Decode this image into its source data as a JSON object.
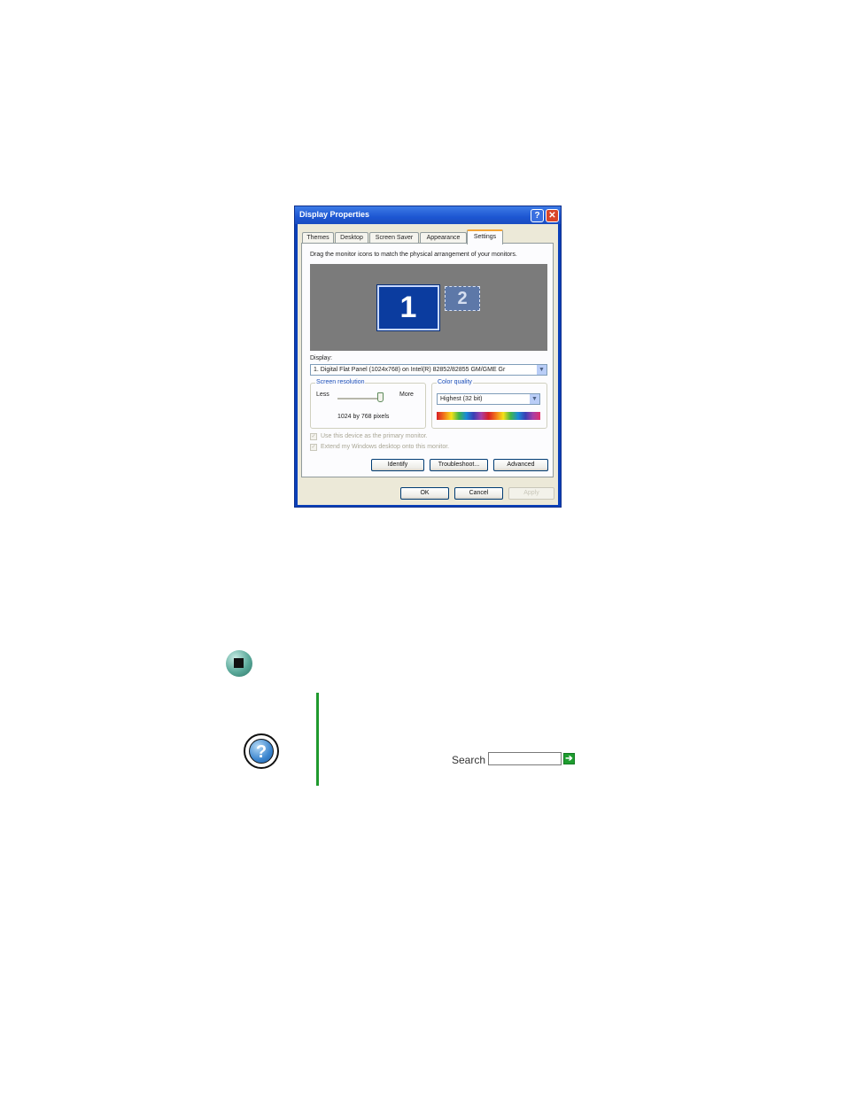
{
  "dialog": {
    "title": "Display Properties",
    "help_glyph": "?",
    "close_glyph": "✕",
    "tabs": [
      {
        "label": "Themes"
      },
      {
        "label": "Desktop"
      },
      {
        "label": "Screen Saver"
      },
      {
        "label": "Appearance"
      },
      {
        "label": "Settings"
      }
    ],
    "active_tab": "Settings",
    "instruction": "Drag the monitor icons to match the physical arrangement of your monitors.",
    "monitors": [
      {
        "label": "1",
        "selected": true
      },
      {
        "label": "2",
        "selected": false
      }
    ],
    "display_label": "Display:",
    "display_value": "1. Digital Flat Panel (1024x768) on Intel(R) 82852/82855 GM/GME Gr",
    "screen_resolution": {
      "title": "Screen resolution",
      "less": "Less",
      "more": "More",
      "value_text": "1024 by 768 pixels",
      "slider_fraction": 1.0
    },
    "color_quality": {
      "title": "Color quality",
      "value": "Highest (32 bit)"
    },
    "checkboxes": [
      {
        "label": "Use this device as the primary monitor.",
        "checked": true,
        "enabled": false
      },
      {
        "label": "Extend my Windows desktop onto this monitor.",
        "checked": true,
        "enabled": false
      }
    ],
    "buttons": {
      "identify": "Identify",
      "troubleshoot": "Troubleshoot...",
      "advanced": "Advanced",
      "ok": "OK",
      "cancel": "Cancel",
      "apply": "Apply"
    },
    "colors": {
      "titlebar": "#1d56d2",
      "face": "#ece9d8",
      "monitor_selected": "#0b3c9f"
    }
  },
  "page": {
    "bullet_icon": "stop-square-bullet-icon",
    "help_icon": "question-mark-help-icon",
    "search_label": "Search",
    "search_value": "",
    "search_go_glyph": "➔",
    "colors": {
      "rule": "#1f9a2e",
      "search_go": "#1e9d2f"
    }
  }
}
